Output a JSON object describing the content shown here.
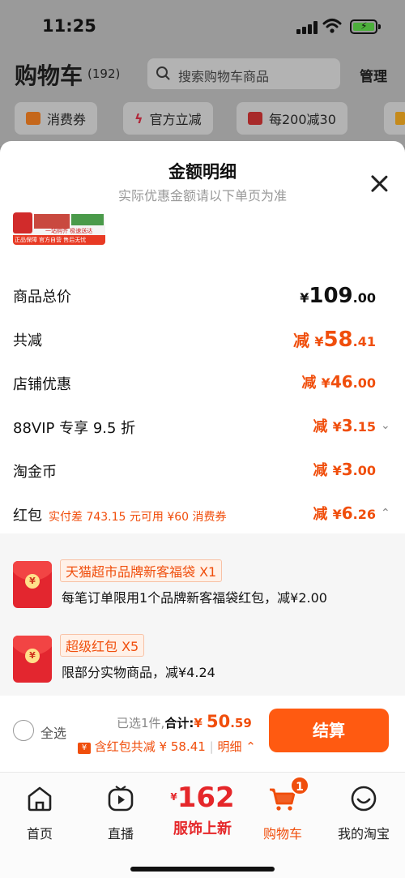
{
  "status_bar": {
    "time": "11:25"
  },
  "header": {
    "title": "购物车",
    "count": "(192)",
    "search_placeholder": "搜索购物车商品",
    "manage": "管理"
  },
  "chips": [
    {
      "label": "消费券",
      "icon": "coupon-icon"
    },
    {
      "label": "官方立减",
      "icon": "lightning-icon"
    },
    {
      "label": "每200减30",
      "icon": "gift-icon"
    }
  ],
  "sheet": {
    "title": "金额明细",
    "subtitle": "实际优惠金额请以下单页为准",
    "thumb": {
      "line1": "一站购齐 极速送达",
      "line2": "官方自营 售后无忧",
      "line3": "正品保障"
    },
    "rows": {
      "total": {
        "label": "商品总价",
        "currency": "¥",
        "int": "109",
        "dec": ".00"
      },
      "reduce": {
        "label": "共减",
        "prefix": "减",
        "currency": "¥",
        "int": "58",
        "dec": ".41"
      },
      "shop": {
        "label": "店铺优惠",
        "prefix": "减",
        "currency": "¥",
        "int": "46",
        "dec": ".00"
      },
      "vip": {
        "label": "88VIP 专享 9.5 折",
        "prefix": "减",
        "currency": "¥",
        "int": "3",
        "dec": ".15"
      },
      "coin": {
        "label": "淘金币",
        "prefix": "减",
        "currency": "¥",
        "int": "3",
        "dec": ".00"
      },
      "redpack": {
        "label": "红包",
        "note": "实付差 743.15 元可用 ¥60 消费券",
        "prefix": "减",
        "currency": "¥",
        "int": "6",
        "dec": ".26"
      }
    },
    "coupons": [
      {
        "tag": "天猫超市品牌新客福袋 X1",
        "desc": "每笔订单限用1个品牌新客福袋红包，减¥2.00"
      },
      {
        "tag": "超级红包 X5",
        "desc": "限部分实物商品，减¥4.24"
      }
    ]
  },
  "checkout": {
    "select_all": "全选",
    "selected": "已选1件,",
    "total_label": "合计:",
    "currency": "¥",
    "total_int": "50",
    "total_dec": ".59",
    "redpack_icon": "¥",
    "redpack_text": "含红包共减 ¥ 58.41",
    "detail": "明细",
    "pay": "结算"
  },
  "tabbar": {
    "home": "首页",
    "live": "直播",
    "promo_yen": "¥",
    "promo_num": "162",
    "promo_label": "服饰上新",
    "cart": "购物车",
    "cart_badge": "1",
    "mine": "我的淘宝"
  },
  "colors": {
    "accent": "#f04e0c",
    "pay_button": "#ff5a11"
  }
}
